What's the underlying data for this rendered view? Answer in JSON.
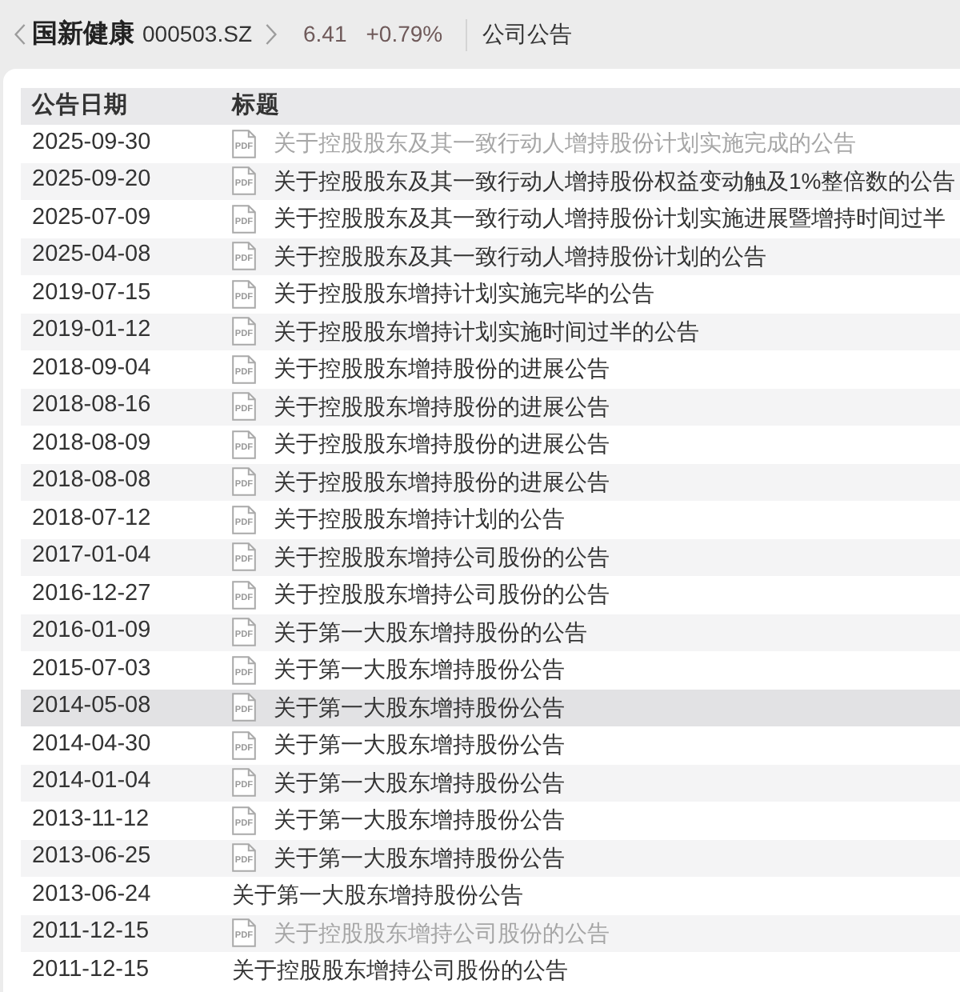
{
  "header": {
    "stock_name": "国新健康",
    "stock_code": "000503.SZ",
    "price": "6.41",
    "change": "+0.79%",
    "page_title": "公司公告"
  },
  "table": {
    "columns": [
      "公告日期",
      "标题"
    ],
    "rows": [
      {
        "date": "2025-09-30",
        "file_type": "PDF",
        "title": "关于控股股东及其一致行动人增持股份计划实施完成的公告",
        "visited": true,
        "selected": false
      },
      {
        "date": "2025-09-20",
        "file_type": "PDF",
        "title": "关于控股股东及其一致行动人增持股份权益变动触及1%整倍数的公告",
        "visited": false,
        "selected": false
      },
      {
        "date": "2025-07-09",
        "file_type": "PDF",
        "title": "关于控股股东及其一致行动人增持股份计划实施进展暨增持时间过半",
        "visited": false,
        "selected": false
      },
      {
        "date": "2025-04-08",
        "file_type": "PDF",
        "title": "关于控股股东及其一致行动人增持股份计划的公告",
        "visited": false,
        "selected": false
      },
      {
        "date": "2019-07-15",
        "file_type": "PDF",
        "title": "关于控股股东增持计划实施完毕的公告",
        "visited": false,
        "selected": false
      },
      {
        "date": "2019-01-12",
        "file_type": "PDF",
        "title": "关于控股股东增持计划实施时间过半的公告",
        "visited": false,
        "selected": false
      },
      {
        "date": "2018-09-04",
        "file_type": "PDF",
        "title": "关于控股股东增持股份的进展公告",
        "visited": false,
        "selected": false
      },
      {
        "date": "2018-08-16",
        "file_type": "PDF",
        "title": "关于控股股东增持股份的进展公告",
        "visited": false,
        "selected": false
      },
      {
        "date": "2018-08-09",
        "file_type": "PDF",
        "title": "关于控股股东增持股份的进展公告",
        "visited": false,
        "selected": false
      },
      {
        "date": "2018-08-08",
        "file_type": "PDF",
        "title": "关于控股股东增持股份的进展公告",
        "visited": false,
        "selected": false
      },
      {
        "date": "2018-07-12",
        "file_type": "PDF",
        "title": "关于控股股东增持计划的公告",
        "visited": false,
        "selected": false
      },
      {
        "date": "2017-01-04",
        "file_type": "PDF",
        "title": "关于控股股东增持公司股份的公告",
        "visited": false,
        "selected": false
      },
      {
        "date": "2016-12-27",
        "file_type": "PDF",
        "title": "关于控股股东增持公司股份的公告",
        "visited": false,
        "selected": false
      },
      {
        "date": "2016-01-09",
        "file_type": "PDF",
        "title": "关于第一大股东增持股份的公告",
        "visited": false,
        "selected": false
      },
      {
        "date": "2015-07-03",
        "file_type": "PDF",
        "title": "关于第一大股东增持股份公告",
        "visited": false,
        "selected": false
      },
      {
        "date": "2014-05-08",
        "file_type": "PDF",
        "title": "关于第一大股东增持股份公告",
        "visited": false,
        "selected": true
      },
      {
        "date": "2014-04-30",
        "file_type": "PDF",
        "title": "关于第一大股东增持股份公告",
        "visited": false,
        "selected": false
      },
      {
        "date": "2014-01-04",
        "file_type": "PDF",
        "title": "关于第一大股东增持股份公告",
        "visited": false,
        "selected": false
      },
      {
        "date": "2013-11-12",
        "file_type": "PDF",
        "title": "关于第一大股东增持股份公告",
        "visited": false,
        "selected": false
      },
      {
        "date": "2013-06-25",
        "file_type": "PDF",
        "title": "关于第一大股东增持股份公告",
        "visited": false,
        "selected": false
      },
      {
        "date": "2013-06-24",
        "title": "关于第一大股东增持股份公告",
        "visited": false,
        "selected": false
      },
      {
        "date": "2011-12-15",
        "file_type": "PDF",
        "title": "关于控股股东增持公司股份的公告",
        "visited": true,
        "selected": false
      },
      {
        "date": "2011-12-15",
        "title": "关于控股股东增持公司股份的公告",
        "visited": false,
        "selected": false
      }
    ]
  }
}
